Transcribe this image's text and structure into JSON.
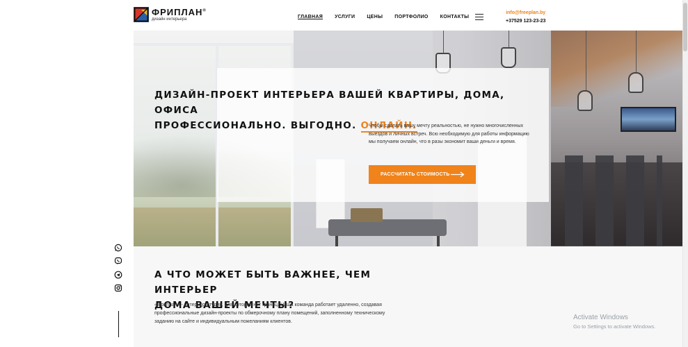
{
  "brand": {
    "name": "ФРИПЛАН",
    "registered": "®",
    "tagline": "дизайн интерьера",
    "colors": {
      "accent": "#f0831a",
      "logo_red": "#d8342a",
      "logo_blue": "#2a5fa5",
      "logo_yellow": "#f2b72a",
      "dark": "#111111"
    }
  },
  "nav": {
    "items": [
      {
        "label": "ГЛАВНАЯ",
        "active": true
      },
      {
        "label": "УСЛУГИ",
        "active": false
      },
      {
        "label": "ЦЕНЫ",
        "active": false
      },
      {
        "label": "ПОРТФОЛИО",
        "active": false
      },
      {
        "label": "КОНТАКТЫ",
        "active": false
      }
    ],
    "menu_icon": "hamburger-icon"
  },
  "contacts": {
    "email": "info@freeplan.by",
    "phone": "+37529 123-23-23"
  },
  "hero": {
    "title_line1": "ДИЗАЙН-ПРОЕКТ ИНТЕРЬЕРА ВАШЕЙ КВАРТИРЫ, ДОМА, ОФИСА",
    "title_line2": "ПРОФЕССИОНАЛЬНО. ВЫГОДНО.",
    "title_accent": "ОНЛАЙН.",
    "description": "Чтобы сделать вашу мечту реальностью, не нужно многочисленных выездов и личных встреч. Всю необходимую для работы информацию мы получаем онлайн, что в разы экономит ваши деньги и время.",
    "cta_label": "РАССЧИТАТЬ СТОИМОСТЬ",
    "cta_icon": "arrow-right-icon"
  },
  "about": {
    "title_line1": "А ЧТО МОЖЕТ БЫТЬ ВАЖНЕЕ, ЧЕМ ИНТЕРЬЕР",
    "title_line2": "ДОМА ВАШЕЙ МЕЧТЫ?",
    "text": "«Фриплан» - интерьер-студия, для которой нет границ. Наша команда работает удаленно, создавая профессиональные дизайн-проекты по обмерочному плану помещений, заполненному техническому заданию на сайте и индивидуальным пожеланиям клиентов."
  },
  "social": [
    {
      "name": "whatsapp-icon"
    },
    {
      "name": "viber-icon"
    },
    {
      "name": "telegram-icon"
    },
    {
      "name": "instagram-icon"
    }
  ],
  "watermark": {
    "line1": "Activate Windows",
    "line2": "Go to Settings to activate Windows."
  }
}
